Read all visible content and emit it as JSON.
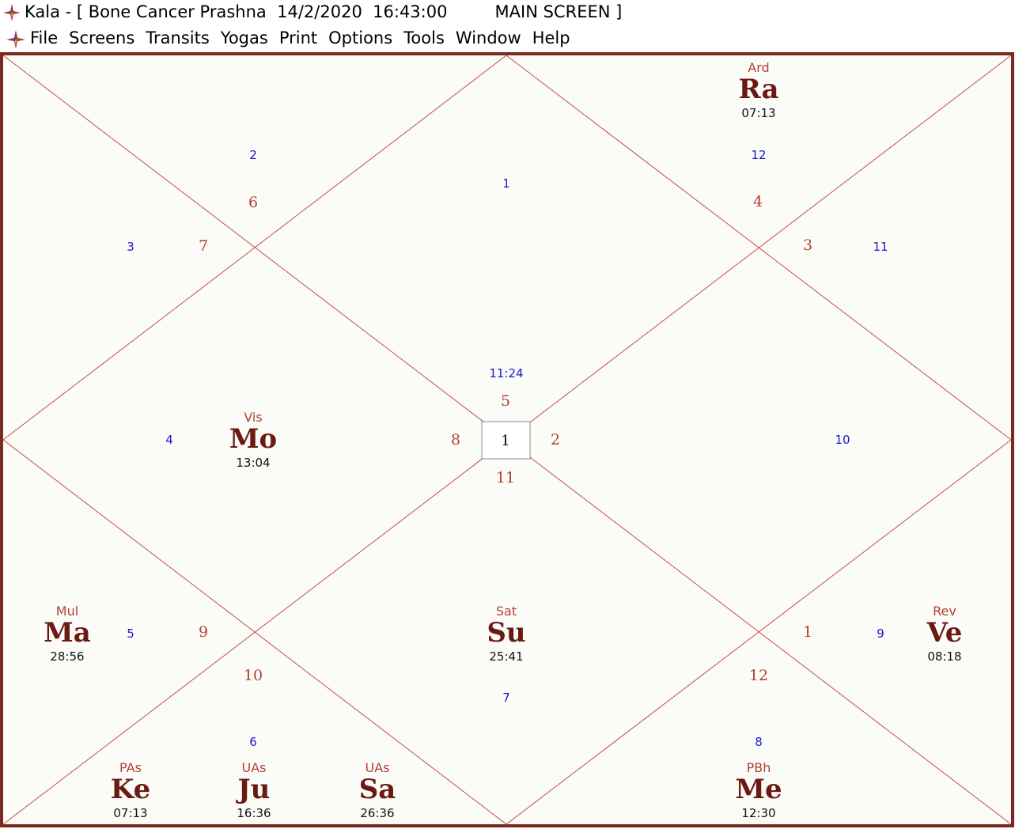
{
  "window": {
    "title": "Kala - [ Bone Cancer Prashna  14/2/2020  16:43:00         MAIN SCREEN ]"
  },
  "menu": [
    "File",
    "Screens",
    "Transits",
    "Yogas",
    "Print",
    "Options",
    "Tools",
    "Window",
    "Help"
  ],
  "chart": {
    "center_value": "1",
    "center_time": "11:24",
    "house_numbers": {
      "h1": "1",
      "h2": "2",
      "h3": "3",
      "h4": "4",
      "h5": "5",
      "h6": "6",
      "h7": "7",
      "h8": "8",
      "h9": "9",
      "h10": "10",
      "h11": "11",
      "h12": "12"
    },
    "sign_numbers": {
      "h1": "5",
      "h2": "6",
      "h3": "7",
      "h4": "8",
      "h5": "9",
      "h6": "10",
      "h7": "11",
      "h8": "12",
      "h9": "1",
      "h10": "2",
      "h11": "3",
      "h12": "4"
    },
    "planets": {
      "ra": {
        "nak": "Ard",
        "abbr": "Ra",
        "deg": "07:13"
      },
      "mo": {
        "nak": "Vis",
        "abbr": "Mo",
        "deg": "13:04"
      },
      "ma": {
        "nak": "Mul",
        "abbr": "Ma",
        "deg": "28:56"
      },
      "su": {
        "nak": "Sat",
        "abbr": "Su",
        "deg": "25:41"
      },
      "ve": {
        "nak": "Rev",
        "abbr": "Ve",
        "deg": "08:18"
      },
      "ke": {
        "nak": "PAs",
        "abbr": "Ke",
        "deg": "07:13"
      },
      "ju": {
        "nak": "UAs",
        "abbr": "Ju",
        "deg": "16:36"
      },
      "sa": {
        "nak": "UAs",
        "abbr": "Sa",
        "deg": "26:36"
      },
      "me": {
        "nak": "PBh",
        "abbr": "Me",
        "deg": "12:30"
      }
    }
  },
  "colors": {
    "background": "#fbfcf8",
    "frame": "#7a2a1e",
    "lines": "#c05040",
    "house_numbers": "#1a1acc",
    "sign_numbers": "#b04030",
    "nakshatra": "#b04030",
    "planet": "#6a1a10",
    "degree": "#111111"
  }
}
